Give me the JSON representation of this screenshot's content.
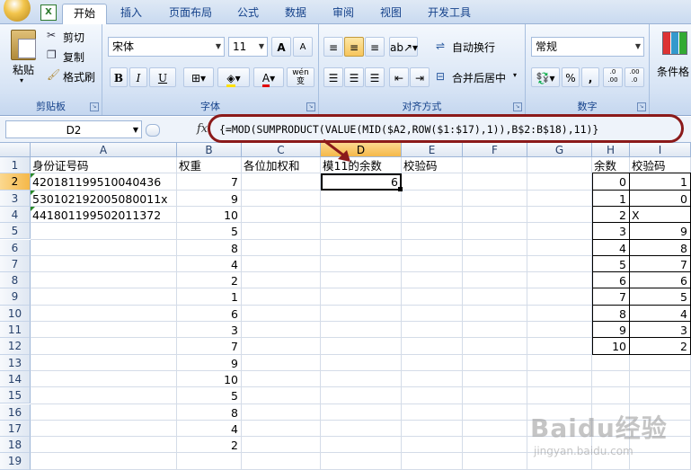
{
  "ribbon": {
    "tabs": [
      "开始",
      "插入",
      "页面布局",
      "公式",
      "数据",
      "审阅",
      "视图",
      "开发工具"
    ],
    "active_tab": "开始",
    "clipboard": {
      "paste": "粘贴",
      "cut": "剪切",
      "copy": "复制",
      "format_painter": "格式刷",
      "label": "剪贴板"
    },
    "font": {
      "name": "宋体",
      "size": "11",
      "grow": "A",
      "shrink": "A",
      "bold": "B",
      "italic": "I",
      "underline": "U",
      "label": "字体",
      "phonetic": "wén 变"
    },
    "alignment": {
      "wrap": "自动换行",
      "merge": "合并后居中",
      "label": "对齐方式"
    },
    "number": {
      "format": "常规",
      "percent": "%",
      "comma": ",",
      "inc_decimal": ".0 .00",
      "dec_decimal": ".00 .0",
      "label": "数字"
    },
    "styles": {
      "conditional": "条件格"
    }
  },
  "formula_bar": {
    "name_box": "D2",
    "fx": "fx",
    "formula": "{=MOD(SUMPRODUCT(VALUE(MID($A2,ROW($1:$17),1)),B$2:B$18),11)}"
  },
  "columns": [
    "A",
    "B",
    "C",
    "D",
    "E",
    "F",
    "G",
    "H",
    "I"
  ],
  "rows": [
    "1",
    "2",
    "3",
    "4",
    "5",
    "6",
    "7",
    "8",
    "9",
    "10",
    "11",
    "12",
    "13",
    "14",
    "15",
    "16",
    "17",
    "18",
    "19"
  ],
  "sheet": {
    "A1": "身份证号码",
    "B1": "权重",
    "C1": "各位加权和",
    "D1": "模11的余数",
    "E1": "校验码",
    "H1": "余数",
    "I1": "校验码",
    "A": [
      "420181199510040436",
      "530102192005080011x",
      "441801199502011372"
    ],
    "B": [
      "7",
      "9",
      "10",
      "5",
      "8",
      "4",
      "2",
      "1",
      "6",
      "3",
      "7",
      "9",
      "10",
      "5",
      "8",
      "4",
      "2"
    ],
    "D2": "6",
    "H": [
      "0",
      "1",
      "2",
      "3",
      "4",
      "5",
      "6",
      "7",
      "8",
      "9",
      "10"
    ],
    "I": [
      "1",
      "0",
      "X",
      "9",
      "8",
      "7",
      "6",
      "5",
      "4",
      "3",
      "2"
    ]
  },
  "watermark": {
    "brand": "Baidu经验",
    "url": "jingyan.baidu.com"
  },
  "colors": {
    "accent": "#15428b",
    "selection": "#f5b849",
    "annotation": "#8b1a1a"
  }
}
